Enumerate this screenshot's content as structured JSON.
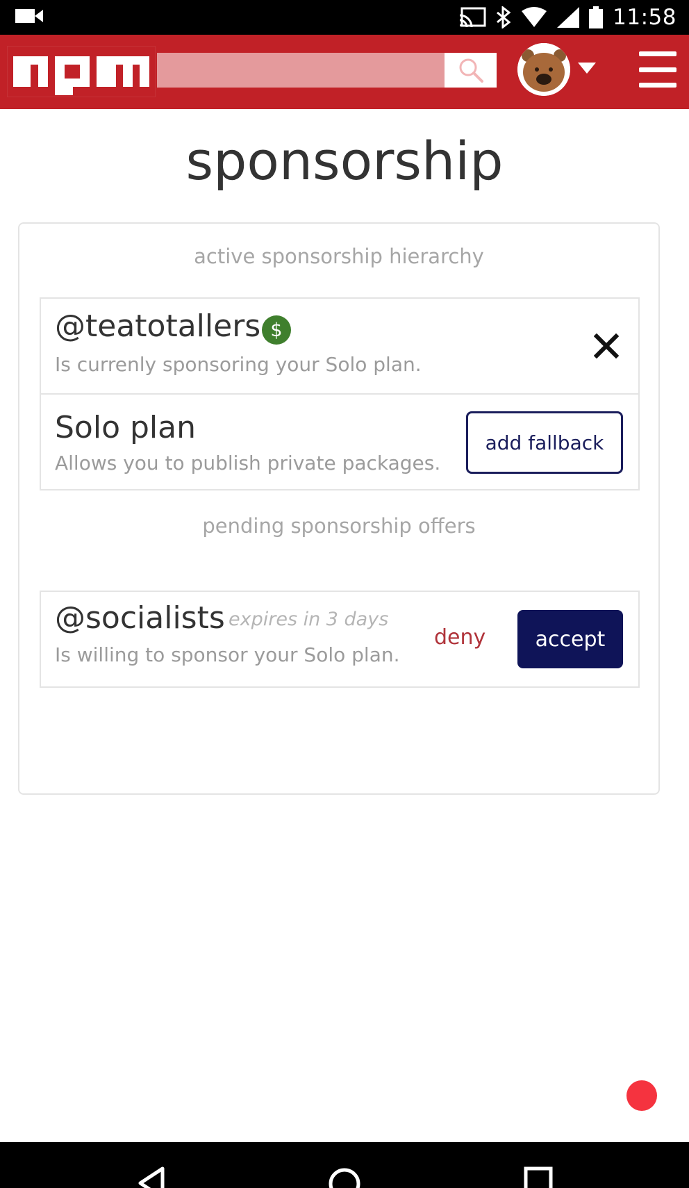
{
  "status_bar": {
    "time": "11:58",
    "icons": [
      "video-camera-icon",
      "cast-icon",
      "bluetooth-icon",
      "wifi-icon",
      "signal-icon",
      "battery-icon"
    ]
  },
  "header": {
    "logo": "npm",
    "search_placeholder": "",
    "icons": [
      "search-icon",
      "wombat-avatar",
      "caret-down-icon",
      "hamburger-menu-icon"
    ],
    "brand_color": "#c12127"
  },
  "page": {
    "title": "sponsorship"
  },
  "active_section": {
    "heading": "active sponsorship hierarchy",
    "sponsor": {
      "name": "@teatotallers",
      "badge": "$",
      "description": "Is currenly sponsoring your Solo plan.",
      "remove_icon": "close-icon"
    },
    "plan": {
      "name": "Solo plan",
      "description": "Allows you to publish private packages.",
      "button_label": "add fallback"
    }
  },
  "pending_section": {
    "heading": "pending sponsorship offers",
    "offers": [
      {
        "name": "@socialists",
        "expires": "expires in 3 days",
        "description": "Is willing to sponsor your Solo plan.",
        "deny_label": "deny",
        "accept_label": "accept"
      }
    ]
  },
  "colors": {
    "accept": "#0f1458",
    "deny": "#b0333a",
    "badge": "#3f7f2d",
    "floating_dot": "#f5333f"
  },
  "nav_bar": {
    "icons": [
      "back-icon",
      "home-icon",
      "recents-icon"
    ]
  }
}
